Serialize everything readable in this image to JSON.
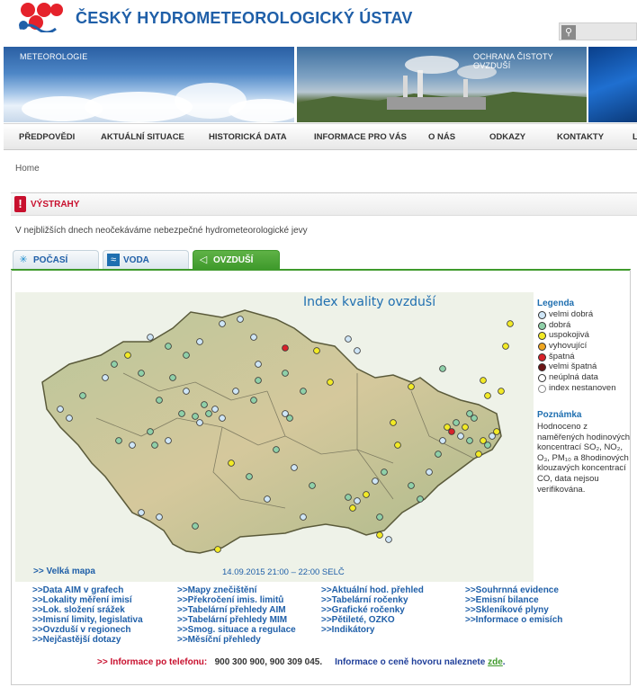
{
  "header": {
    "title": "ČESKÝ HYDROMETEOROLOGICKÝ ÚSTAV",
    "banner_left_label": "METEOROLOGIE",
    "banner_right_label": "OCHRANA ČISTOTY OVZDUŠÍ"
  },
  "nav": [
    "PŘEDPOVĚDI",
    "AKTUÁLNÍ  SITUACE",
    "HISTORICKÁ DATA",
    "INFORMACE PRO VÁS",
    "O NÁS",
    "ODKAZY",
    "KONTAKTY",
    "L"
  ],
  "breadcrumb": "Home",
  "warnings": {
    "title": "VÝSTRAHY",
    "text": "V nejbližších dnech neočekáváme nebezpečné hydrometeorologické jevy"
  },
  "tabs": [
    "POČASÍ",
    "VODA",
    "OVZDUŠÍ"
  ],
  "map": {
    "title": "Index kvality ovzduší",
    "date": "14.09.2015 21:00 – 22:00 SELČ",
    "big_map_link": ">> Velká mapa"
  },
  "legend": {
    "title": "Legenda",
    "items": [
      {
        "label": "velmi dobrá",
        "color": "#cfe6f7"
      },
      {
        "label": "dobrá",
        "color": "#8fd0a9"
      },
      {
        "label": "uspokojivá",
        "color": "#f2ea26"
      },
      {
        "label": "vyhovující",
        "color": "#f0a620"
      },
      {
        "label": "špatná",
        "color": "#d8222a"
      },
      {
        "label": "velmi špatná",
        "color": "#6b1414"
      },
      {
        "label": "neúplná data",
        "color": "#ffffff"
      },
      {
        "label": "index nestanoven",
        "color": "#ffffff"
      }
    ]
  },
  "note": {
    "title": "Poznámka",
    "text": "Hodnoceno z naměřených hodinových koncentrací SO₂, NO₂, O₃, PM₁₀ a 8hodinových klouzavých koncentrací CO, data nejsou verifikována."
  },
  "links": [
    [
      ">>Data AIM v grafech",
      ">>Lokality měření imisí",
      ">>Lok. složení srážek",
      ">>Imisní limity, legislativa",
      ">>Ovzduší v regionech",
      ">>Nejčastější dotazy"
    ],
    [
      ">>Mapy znečištění",
      ">>Překročení imis. limitů",
      ">>Tabelární přehledy AIM",
      ">>Tabelární přehledy MIM",
      ">>Smog. situace a regulace",
      ">>Měsíční přehledy"
    ],
    [
      ">>Aktuální hod. přehled",
      ">>Tabelární ročenky",
      ">>Grafické ročenky",
      ">>Pětileté, OZKO",
      ">>Indikátory"
    ],
    [
      ">>Souhrnná evidence",
      ">>Emisní bilance",
      ">>Skleníkové plyny",
      ">>Informace o emisích"
    ]
  ],
  "phone": {
    "label": ">> Informace po telefonu:",
    "numbers": "900 300 900,   900 309 045.",
    "info": "Informace o ceně hovoru naleznete",
    "here": "zde",
    "end": "."
  }
}
